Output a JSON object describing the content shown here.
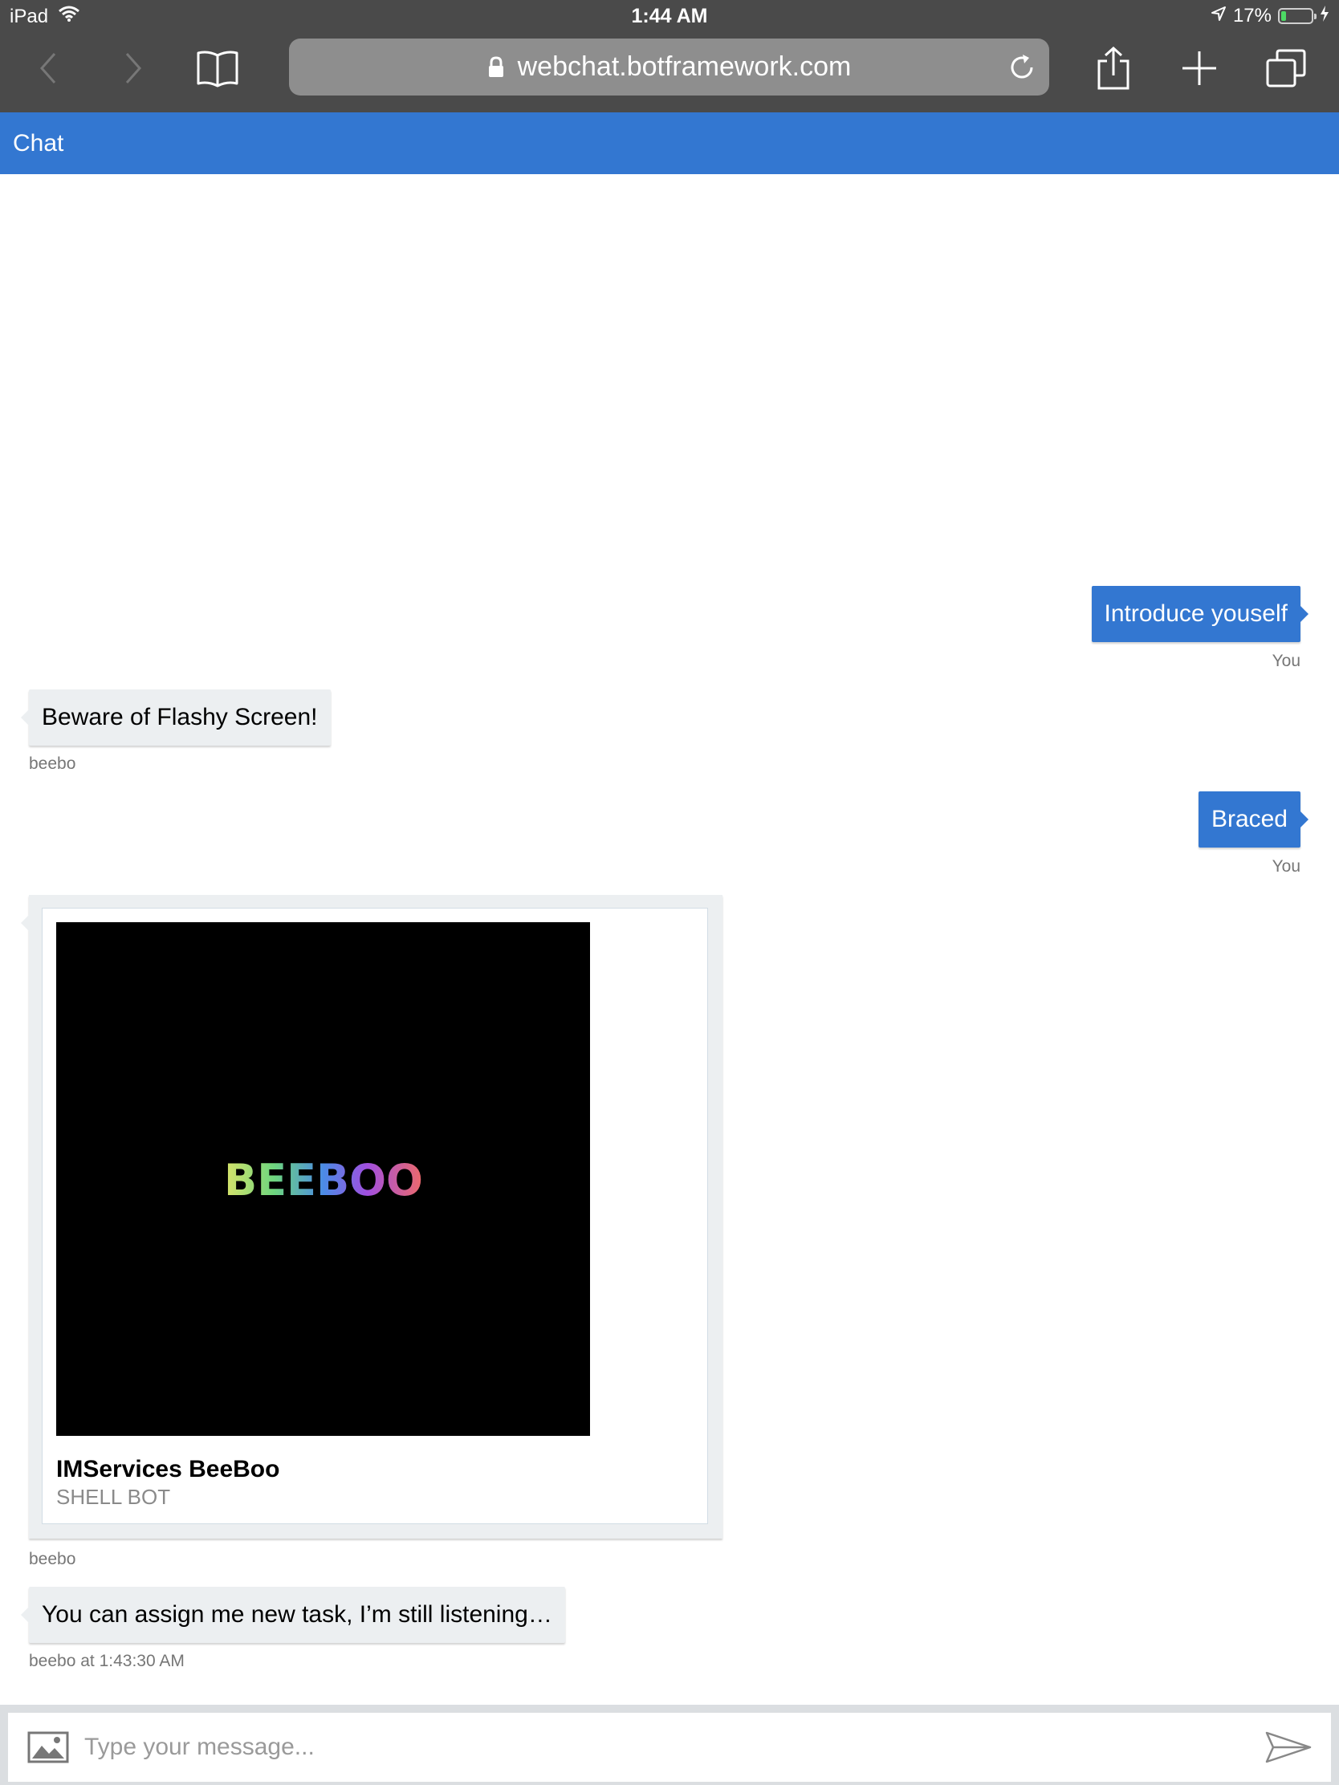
{
  "status_bar": {
    "device": "iPad",
    "time": "1:44 AM",
    "battery_text": "17%",
    "battery_level": 0.17
  },
  "browser": {
    "url": "webchat.botframework.com"
  },
  "chat": {
    "title": "Chat"
  },
  "messages": [
    {
      "from": "user",
      "text": "Introduce youself",
      "meta": "You"
    },
    {
      "from": "bot",
      "text": "Beware of Flashy Screen!",
      "meta": "beebo"
    },
    {
      "from": "user",
      "text": "Braced",
      "meta": "You"
    },
    {
      "from": "bot",
      "card": {
        "image_text": "BEEBOO",
        "title": "IMServices BeeBoo",
        "subtitle": "SHELL BOT"
      },
      "meta": "beebo"
    },
    {
      "from": "bot",
      "text": "You can assign me new task, I’m still listening…",
      "meta": "beebo at 1:43:30 AM"
    }
  ],
  "input": {
    "placeholder": "Type your message..."
  },
  "colors": {
    "accent": "#3377d1",
    "bot_bubble": "#eceff1",
    "browser_chrome": "#4a4a4a"
  }
}
